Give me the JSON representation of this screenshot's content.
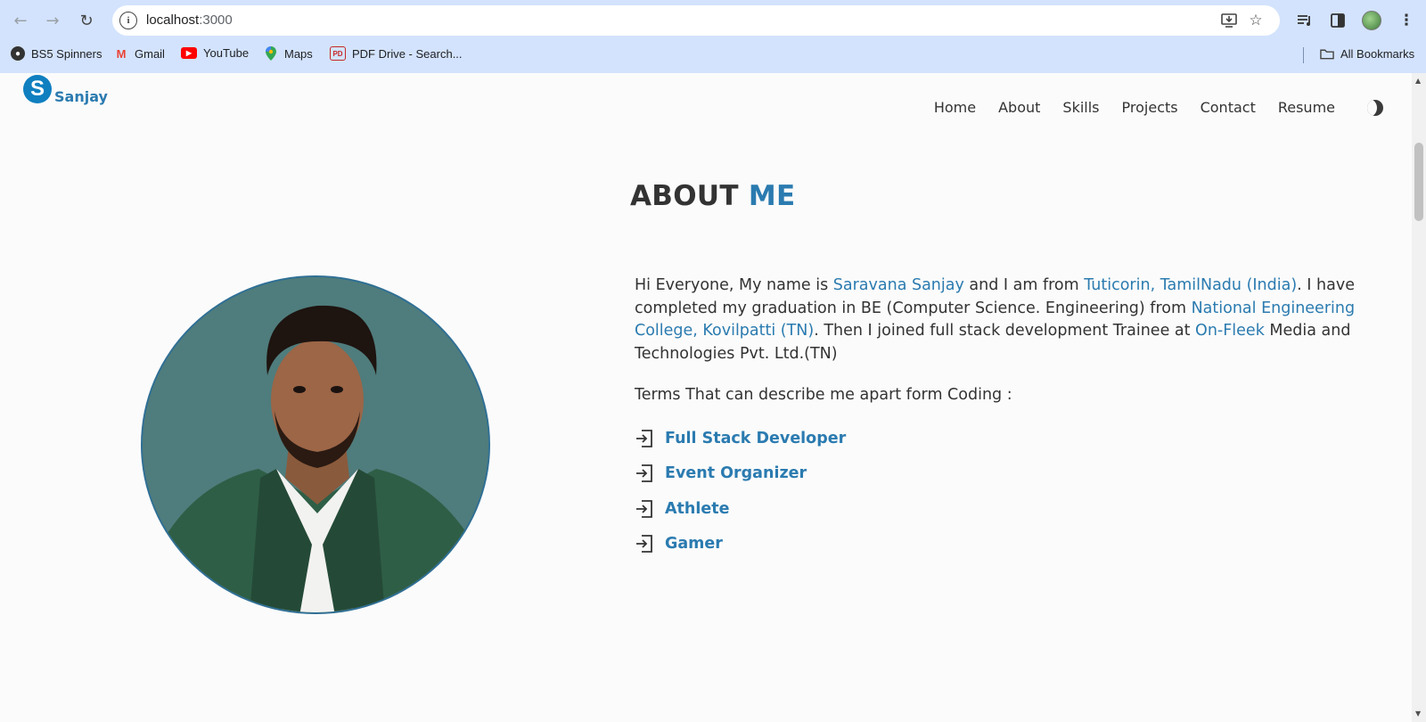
{
  "browser": {
    "url_host": "localhost",
    "url_port": ":3000",
    "bookmarks": [
      {
        "label": "BS5 Spinners",
        "icon": "globe-icon"
      },
      {
        "label": "Gmail",
        "icon": "gmail-icon"
      },
      {
        "label": "YouTube",
        "icon": "youtube-icon"
      },
      {
        "label": "Maps",
        "icon": "maps-icon"
      },
      {
        "label": "PDF Drive - Search...",
        "icon": "pdf-drive-icon"
      }
    ],
    "all_bookmarks": "All Bookmarks"
  },
  "site": {
    "logo_letter": "S",
    "logo_text": "Sanjay",
    "nav": [
      "Home",
      "About",
      "Skills",
      "Projects",
      "Contact",
      "Resume"
    ]
  },
  "about": {
    "heading_main": "ABOUT",
    "heading_highlight": "ME",
    "intro": {
      "p1": "Hi Everyone, My name is ",
      "name": "Saravana Sanjay",
      "p2": " and I am from ",
      "place": "Tuticorin, TamilNadu (India)",
      "p3": ". I have completed my graduation in BE (Computer Science. Engineering) from ",
      "college": "National Engineering College, Kovilpatti (TN)",
      "p4": ". Then I joined full stack development Trainee at ",
      "company": "On-Fleek",
      "p5": " Media and Technologies Pvt. Ltd.(TN)"
    },
    "terms_title": "Terms That can describe me apart form Coding :",
    "terms": [
      "Full Stack Developer",
      "Event Organizer",
      "Athlete",
      "Gamer"
    ]
  },
  "colors": {
    "accent": "#2b7bb0",
    "logo_badge": "#0f7fc0",
    "chrome_bg": "#d3e3fd",
    "text": "#333333"
  }
}
